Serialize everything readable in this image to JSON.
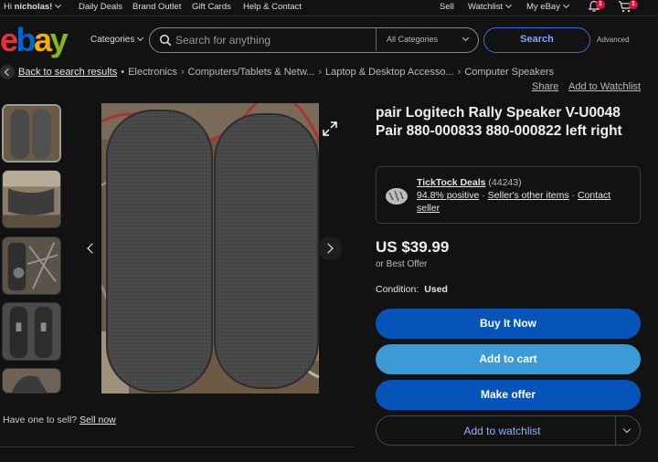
{
  "topbar": {
    "greeting_prefix": "Hi ",
    "greeting_name": "nicholas!",
    "daily_deals": "Daily Deals",
    "brand_outlet": "Brand Outlet",
    "gift_cards": "Gift Cards",
    "help_contact": "Help & Contact",
    "sell": "Sell",
    "watchlist": "Watchlist",
    "my_ebay": "My eBay",
    "notification_count": "1",
    "cart_count": "1"
  },
  "header": {
    "logo": {
      "e": "e",
      "b": "b",
      "a": "a",
      "y": "y"
    },
    "categories_label": "Categories",
    "search_placeholder": "Search for anything",
    "category_select": "All Categories",
    "search_button": "Search",
    "advanced": "Advanced"
  },
  "breadcrumb": {
    "back": "Back to search results",
    "items": [
      "Electronics",
      "Computers/Tablets & Netw...",
      "Laptop & Desktop Accesso...",
      "Computer Speakers"
    ],
    "share": "Share",
    "add_to_watchlist": "Add to Watchlist"
  },
  "gallery": {
    "sell_prompt": "Have one to sell?",
    "sell_now": "Sell now"
  },
  "listing": {
    "title": "pair Logitech Rally Speaker V-U0048 Pair 880-000833 880-000822 left right",
    "seller": {
      "name": "TickTock Deals",
      "feedback_count": "(44243)",
      "positive": "94.8% positive",
      "other_items": "Seller's other items",
      "contact": "Contact seller"
    },
    "price": "US $39.99",
    "best_offer": "or Best Offer",
    "condition_label": "Condition:",
    "condition_value": "Used"
  },
  "actions": {
    "buy_now": "Buy It Now",
    "add_to_cart": "Add to cart",
    "make_offer": "Make offer",
    "add_to_watchlist": "Add to watchlist"
  },
  "colors": {
    "primary_button": "#0654ba",
    "cart_button": "#3b9bd6",
    "background": "#121212"
  }
}
